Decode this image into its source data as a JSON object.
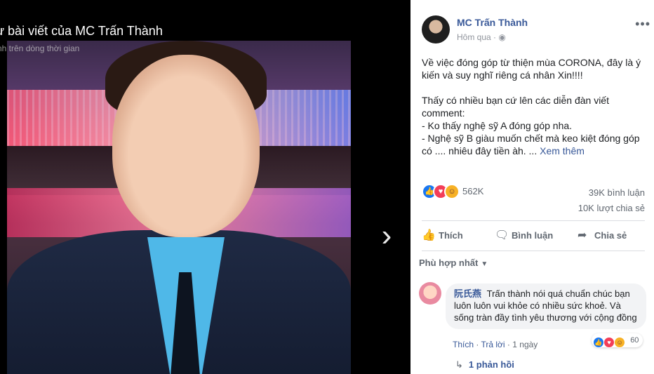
{
  "viewer": {
    "title": "ừ bài viết của MC Trấn Thành",
    "subtitle": "nh trên dòng thời gian",
    "next_icon": "chevron-right-icon"
  },
  "post": {
    "author": "MC Trấn Thành",
    "time": "Hôm qua",
    "privacy_icon": "globe-icon",
    "more_icon": "•••",
    "paragraph1": "Về việc đóng góp từ thiện mùa CORONA, đây là ý kiến và suy nghĩ riêng cá nhân Xin!!!!",
    "paragraph2_lines": [
      "Thấy có nhiều bạn cứ lên các diễn đàn viết comment:",
      "- Ko thấy nghệ sỹ A đóng góp nha.",
      "- Nghệ sỹ B giàu muốn chết mà keo kiệt đóng góp có .... nhiêu đây tiền àh. ..."
    ],
    "see_more": "Xem thêm",
    "reaction_count": "562K",
    "comments_count": "39K bình luận",
    "shares_count": "10K lượt chia sẻ",
    "colors": {
      "link": "#385898",
      "like": "#1877f2",
      "love": "#f33e58",
      "haha": "#f7b125"
    }
  },
  "actions": {
    "like": "Thích",
    "comment": "Bình luận",
    "share": "Chia sẻ"
  },
  "comments": {
    "sort_label": "Phù hợp nhất",
    "items": [
      {
        "name": "阮氏燕",
        "text": "Trấn thành nói quá chuẩn chúc bạn luôn luôn vui khỏe có nhiều sức khoẻ. Và sống tràn đầy tình yêu thương với cộng đồng",
        "like": "Thích",
        "reply": "Trả lời",
        "time": "1 ngày",
        "reactions": "60",
        "replies": "1 phản hồi"
      }
    ]
  }
}
